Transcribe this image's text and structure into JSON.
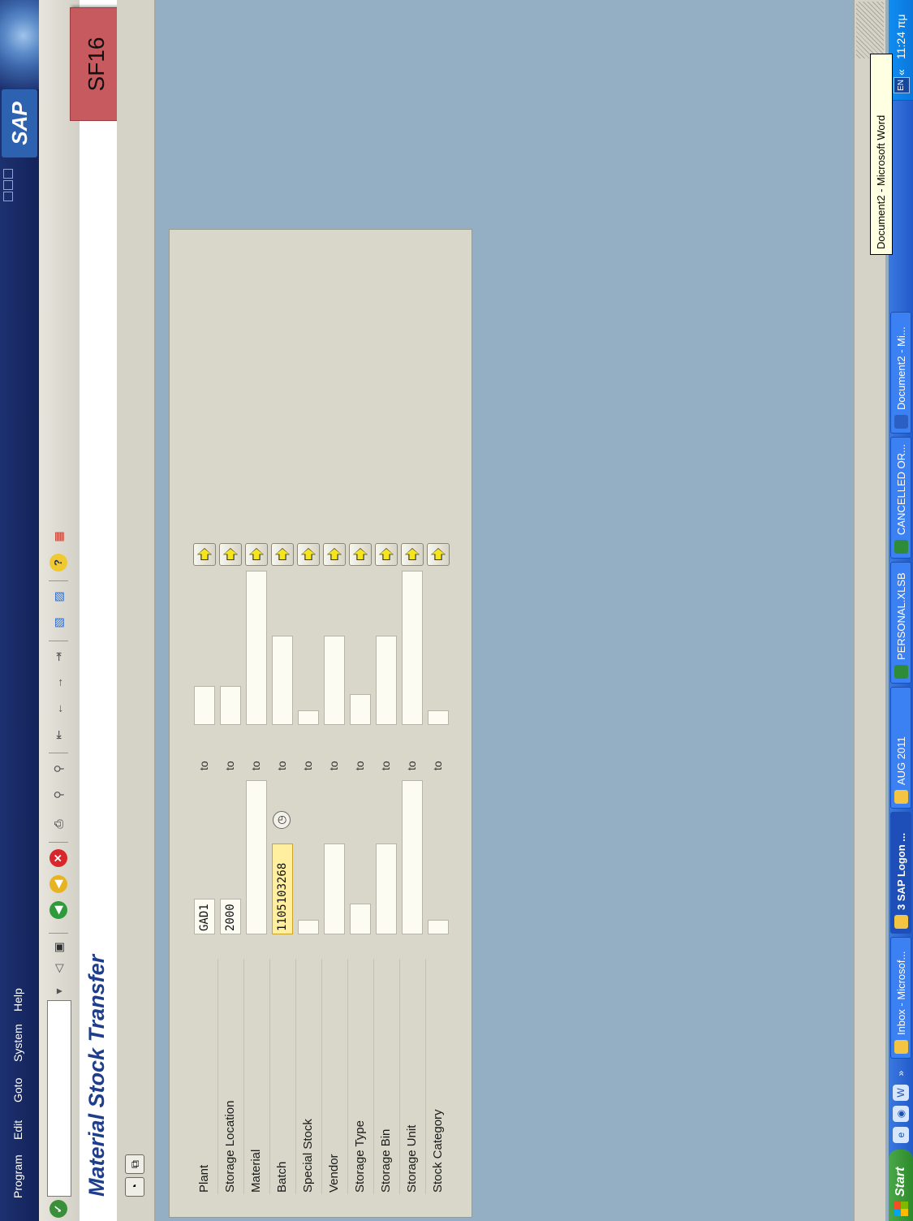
{
  "menu": {
    "items": [
      "Program",
      "Edit",
      "Goto",
      "System",
      "Help"
    ]
  },
  "toolbar": {
    "buttons": [
      "enter-icon",
      "save-icon",
      "back-icon",
      "exit-icon",
      "cancel-icon",
      "print-icon",
      "find-icon",
      "find-next-icon",
      "first-page-icon",
      "previous-page-icon",
      "next-page-icon",
      "last-page-icon",
      "create-session-icon",
      "shortcut-icon",
      "help-icon",
      "customize-layout-icon"
    ]
  },
  "title": {
    "text": "Material Stock Transfer"
  },
  "overlay": {
    "tag": "SF16"
  },
  "app_toolbar": {
    "buttons": [
      "execute-icon",
      "get-variant-icon"
    ]
  },
  "form": {
    "to_label": "to",
    "rows": [
      {
        "label": "Plant",
        "from": "GAD1",
        "to": ""
      },
      {
        "label": "Storage Location",
        "from": "2000",
        "to": ""
      },
      {
        "label": "Material",
        "from": "",
        "to": ""
      },
      {
        "label": "Batch",
        "from": "1105103268",
        "to": ""
      },
      {
        "label": "Special Stock",
        "from": "",
        "to": ""
      },
      {
        "label": "Vendor",
        "from": "",
        "to": ""
      },
      {
        "label": "Storage Type",
        "from": "",
        "to": ""
      },
      {
        "label": "Storage Bin",
        "from": "",
        "to": ""
      },
      {
        "label": "Storage Unit",
        "from": "",
        "to": ""
      },
      {
        "label": "Stock Category",
        "from": "",
        "to": ""
      }
    ]
  },
  "tooltip": {
    "text": "Document2 - Microsoft Word"
  },
  "taskbar": {
    "start": "Start",
    "quicklaunch_more": "»",
    "tasks": [
      "Inbox - Microsof...",
      "3 SAP Logon ...",
      "AUG 2011",
      "PERSONAL.XLSB",
      "CANCELLED OR...",
      "Document2 - Mi..."
    ],
    "tray_lang": "EN",
    "tray_more": "«",
    "clock": "11:24 πμ"
  },
  "colors": {
    "sap_blue": "#1d3170",
    "content_bg": "#94afc3",
    "highlight_field": "#ffef9e",
    "sf16_tag": "#c75a5e",
    "title_text": "#1e3e8c"
  }
}
